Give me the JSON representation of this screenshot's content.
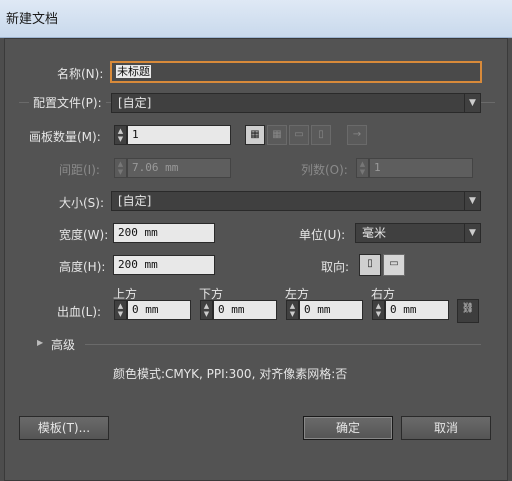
{
  "window": {
    "title": "新建文档"
  },
  "name": {
    "label": "名称(N):",
    "value": "未标题"
  },
  "profile": {
    "label": "配置文件(P):",
    "value": "[自定]"
  },
  "artboards": {
    "label": "画板数量(M):",
    "value": "1"
  },
  "spacing": {
    "label": "间距(I):",
    "value": "7.06 mm"
  },
  "columns": {
    "label": "列数(O):",
    "value": "1"
  },
  "size": {
    "label": "大小(S):",
    "value": "[自定]"
  },
  "width": {
    "label": "宽度(W):",
    "value": "200 mm"
  },
  "units": {
    "label": "单位(U):",
    "value": "毫米"
  },
  "height": {
    "label": "高度(H):",
    "value": "200 mm"
  },
  "orientation": {
    "label": "取向:"
  },
  "bleed": {
    "label": "出血(L):",
    "top": {
      "label": "上方",
      "value": "0 mm"
    },
    "bottom": {
      "label": "下方",
      "value": "0 mm"
    },
    "left": {
      "label": "左方",
      "value": "0 mm"
    },
    "right": {
      "label": "右方",
      "value": "0 mm"
    }
  },
  "advanced": {
    "label": "高级"
  },
  "info": {
    "text": "颜色模式:CMYK, PPI:300, 对齐像素网格:否"
  },
  "buttons": {
    "templates": "模板(T)...",
    "ok": "确定",
    "cancel": "取消"
  },
  "icons": {
    "arrow_right": "→",
    "dropdown": "▼",
    "triangle": "▶",
    "link": "⛓"
  }
}
